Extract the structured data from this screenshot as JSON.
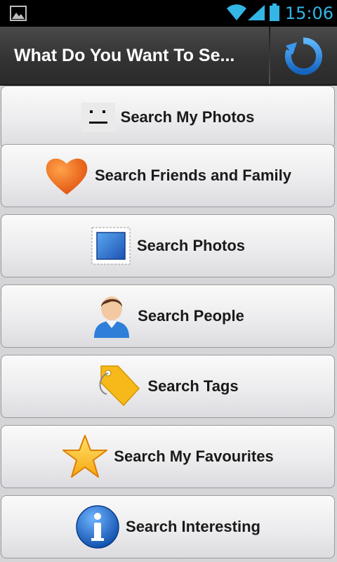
{
  "status_bar": {
    "time": "15:06",
    "icons": [
      "image-notification-icon",
      "wifi-icon",
      "signal-icon",
      "battery-icon"
    ]
  },
  "header": {
    "title": "What Do You Want To Se...",
    "refresh_icon": "refresh-icon"
  },
  "menu": {
    "items": [
      {
        "label": "Search My Photos",
        "icon": "face-icon"
      },
      {
        "label": "Search Friends and Family",
        "icon": "heart-icon"
      },
      {
        "label": "Search Photos",
        "icon": "stamp-icon"
      },
      {
        "label": "Search People",
        "icon": "person-icon"
      },
      {
        "label": "Search Tags",
        "icon": "tag-icon"
      },
      {
        "label": "Search My Favourites",
        "icon": "star-icon"
      },
      {
        "label": "Search Interesting",
        "icon": "info-icon"
      }
    ]
  },
  "colors": {
    "status_accent": "#33b5e5",
    "title_bar": "#333333",
    "refresh_blue": "#2a86d6",
    "heart": "#f26a1b",
    "star": "#f7c21f",
    "tag": "#f7b91a",
    "info": "#1a66c9"
  }
}
